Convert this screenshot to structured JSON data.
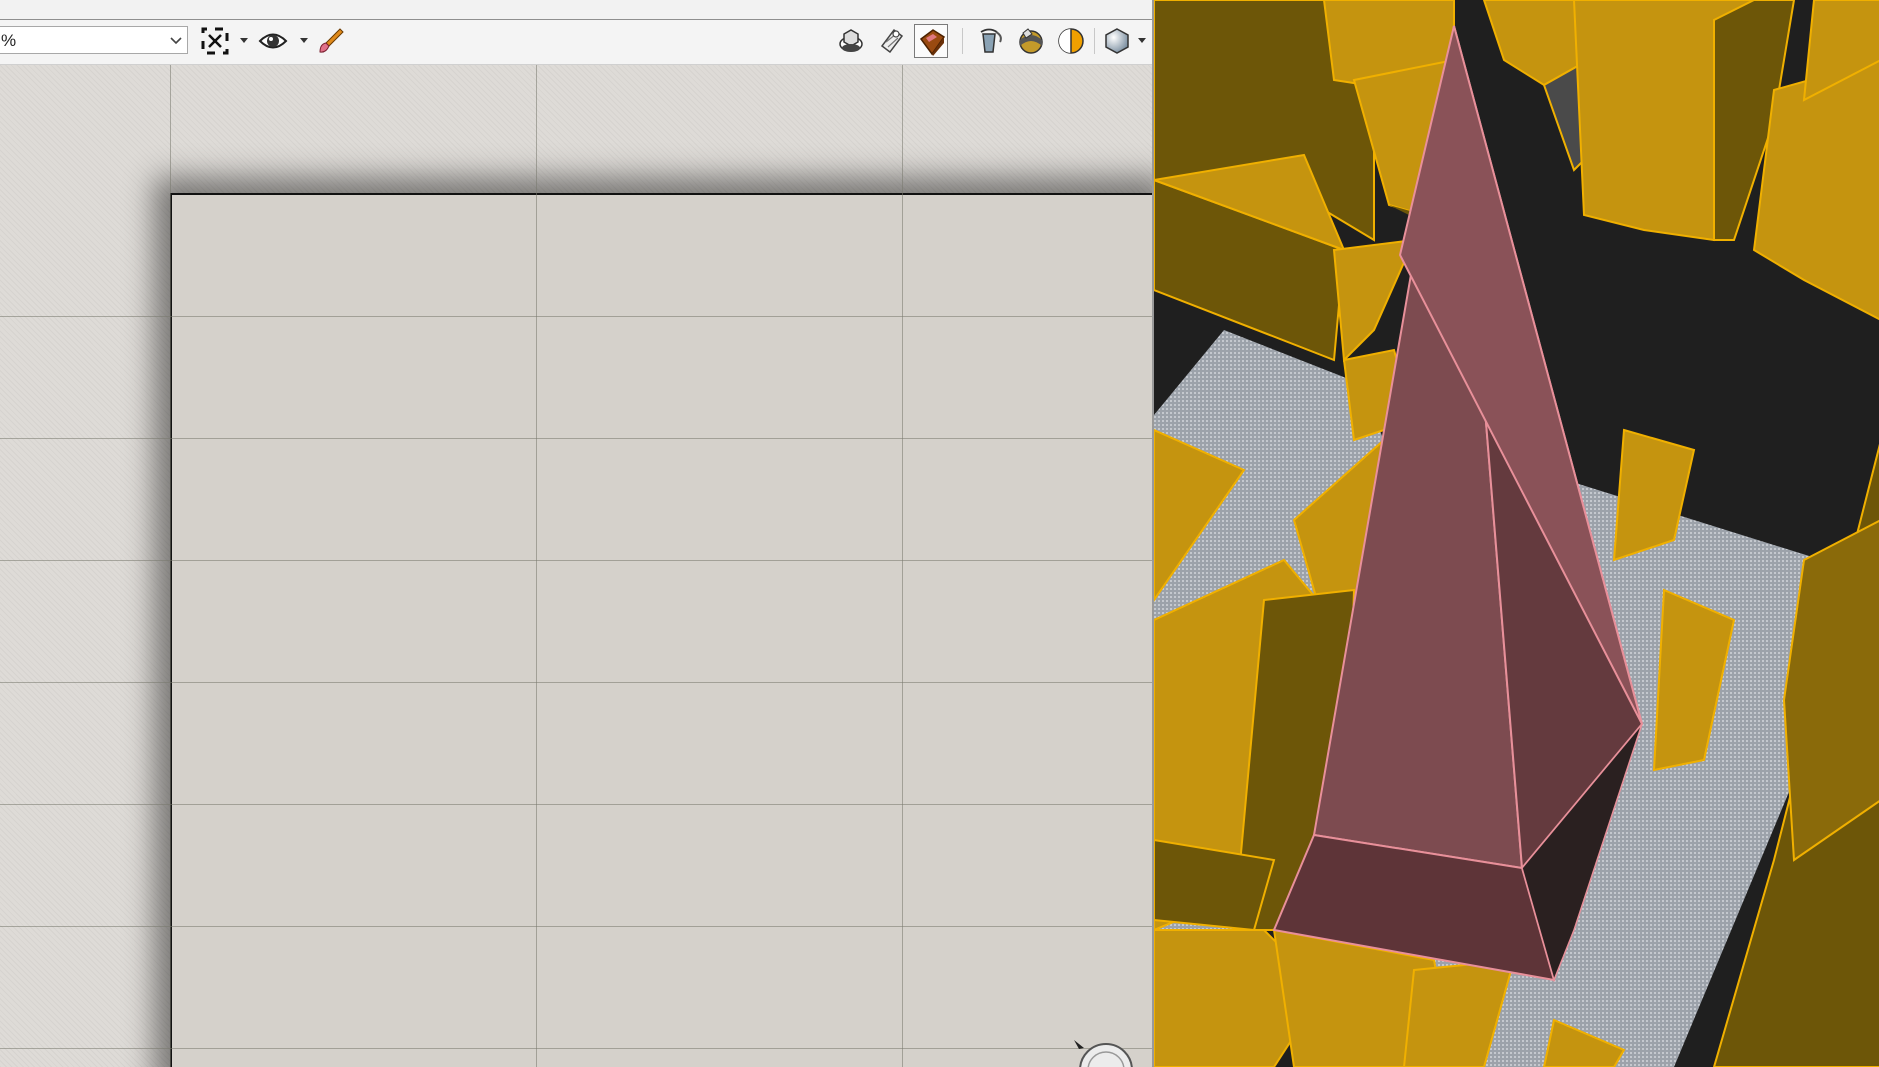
{
  "toolbar": {
    "zoom_value": "%",
    "buttons": [
      {
        "name": "fit-page-icon"
      },
      {
        "name": "eye-icon"
      },
      {
        "name": "paint-brush-icon"
      },
      {
        "name": "hidden-line-icon"
      },
      {
        "name": "wireframe-icon"
      },
      {
        "name": "textured-icon"
      },
      {
        "name": "paint-bucket-icon"
      },
      {
        "name": "shaded-icon"
      },
      {
        "name": "half-shaded-icon"
      },
      {
        "name": "sphere-render-icon"
      }
    ]
  },
  "colors": {
    "building_fill": "#c5940f",
    "building_edge": "#f0b000",
    "building_dark": "#6d5608",
    "pyramid_light": "#8a5258",
    "pyramid_mid": "#7d4b50",
    "pyramid_dark": "#643a3e",
    "pyramid_edge": "#e8909a",
    "ground_texture": "#a8aeb6",
    "sky": "#1f1f1f",
    "paper": "#d5d1cb"
  }
}
